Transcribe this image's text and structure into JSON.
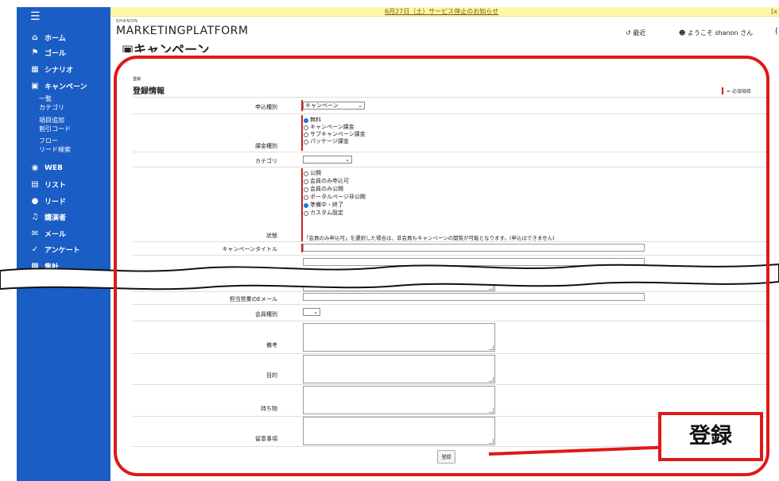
{
  "topbar": {
    "notice": "6月27日（土）サービス停止のお知らせ",
    "right_link": "[x"
  },
  "sidebar": {
    "menu_icon": "hamburger-icon",
    "items": [
      {
        "icon": "home-icon",
        "label": "ホーム"
      },
      {
        "icon": "flag-icon",
        "label": "ゴール"
      },
      {
        "icon": "scenario-icon",
        "label": "シナリオ"
      },
      {
        "icon": "calendar-icon",
        "label": "キャンペーン"
      },
      {
        "icon": "globe-icon",
        "label": "WEB"
      },
      {
        "icon": "list-icon",
        "label": "リスト"
      },
      {
        "icon": "person-icon",
        "label": "リード"
      },
      {
        "icon": "mic-icon",
        "label": "講演者"
      },
      {
        "icon": "mail-icon",
        "label": "メール"
      },
      {
        "icon": "check-icon",
        "label": "アンケート"
      },
      {
        "icon": "chart-icon",
        "label": "集計"
      }
    ],
    "campaign_subitems": [
      "一覧",
      "カテゴリ",
      "項目追加",
      "割引コード",
      "フロー",
      "リード検索"
    ]
  },
  "header": {
    "brand_small": "SHANON",
    "brand": "MARKETINGPLATFORM",
    "recent": "最近",
    "welcome": "ようこそ",
    "user": "shanon",
    "suffix": "さん"
  },
  "page": {
    "title": "キャンペーン",
    "breadcrumb": "登録",
    "section_title": "登録情報",
    "required_legend": "= 必須項目"
  },
  "form": {
    "application_type": {
      "label": "申込種別",
      "value": "キャンペーン"
    },
    "billing_type": {
      "label": "課金種別",
      "options": [
        "無料",
        "キャンペーン課金",
        "サブキャンペーン課金",
        "パッケージ課金"
      ],
      "selected": "無料"
    },
    "category": {
      "label": "カテゴリ",
      "value": ""
    },
    "status": {
      "label": "状態",
      "options": [
        "公開",
        "会員のみ申込可",
        "会員のみ公開",
        "ポータルページ非公開",
        "準備中・終了",
        "カスタム設定"
      ],
      "selected": "準備中・終了",
      "note": "「会員のみ申込可」を選択した場合は、非会員もキャンペーンの閲覧が可能となります。(申込はできません)"
    },
    "campaign_title": {
      "label": "キャンペーンタイトル",
      "value": ""
    },
    "staff_email": {
      "label": "担当営業のEメール",
      "value": ""
    },
    "member_type": {
      "label": "会員種別",
      "value": ""
    },
    "remarks": {
      "label": "備考"
    },
    "purpose": {
      "label": "目的"
    },
    "belongings": {
      "label": "持ち物"
    },
    "precautions": {
      "label": "留意事項"
    },
    "submit_label": "登録"
  },
  "annotation": {
    "callout_text": "登録",
    "color": "#e01818"
  },
  "colors": {
    "sidebar": "#1a5dc4",
    "notice_bar": "#fff7a8",
    "required": "#cc2222"
  }
}
